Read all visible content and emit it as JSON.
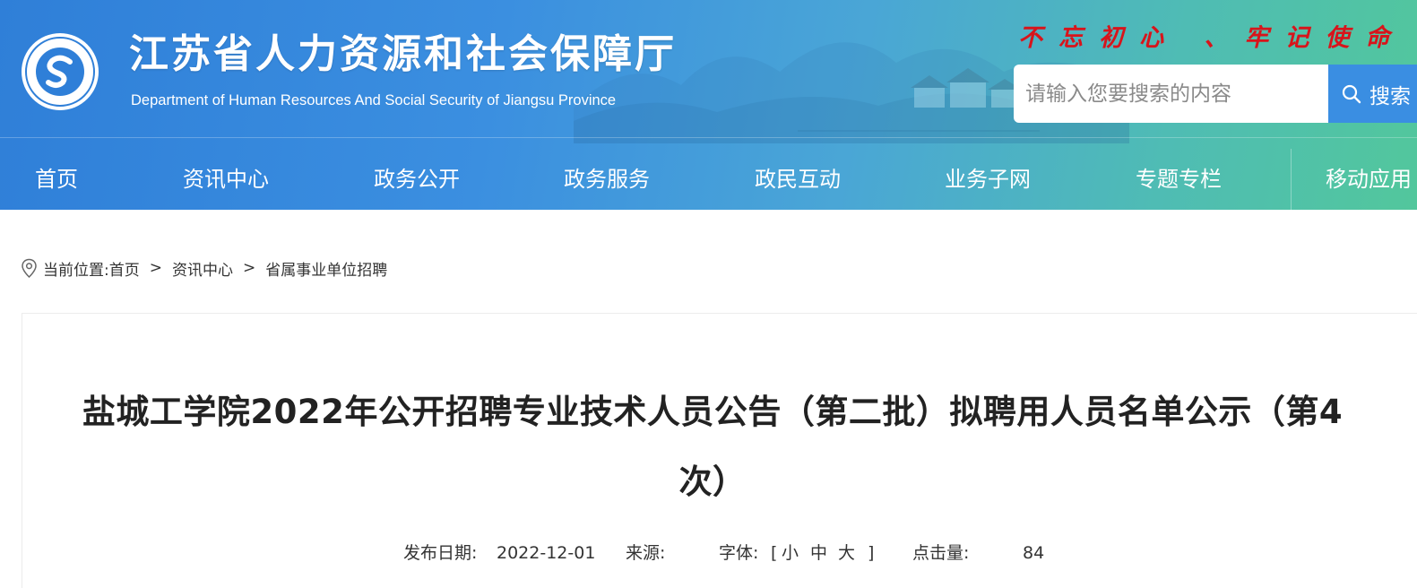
{
  "header": {
    "site_title": "江苏省人力资源和社会保障厅",
    "site_subtitle": "Department of Human Resources And Social Security of Jiangsu Province",
    "slogan": "不忘初心 、牢记使命",
    "emblem_icon": "jiangsu-hrss-emblem-icon"
  },
  "search": {
    "placeholder": "请输入您要搜索的内容",
    "button_label": "搜索"
  },
  "nav": {
    "items": [
      {
        "label": "首页"
      },
      {
        "label": "资讯中心"
      },
      {
        "label": "政务公开"
      },
      {
        "label": "政务服务"
      },
      {
        "label": "政民互动"
      },
      {
        "label": "业务子网"
      },
      {
        "label": "专题专栏"
      },
      {
        "label": "移动应用"
      }
    ]
  },
  "breadcrumb": {
    "prefix": "当前位置:",
    "items": [
      "首页",
      "资讯中心",
      "省属事业单位招聘"
    ],
    "separator": ">"
  },
  "article": {
    "title": "盐城工学院2022年公开招聘专业技术人员公告（第二批）拟聘用人员名单公示（第4次）",
    "date_label": "发布日期:",
    "date": "2022-12-01",
    "source_label": "来源:",
    "source": "",
    "font_label": "字体:",
    "font_open": "[",
    "font_small": "小",
    "font_medium": "中",
    "font_large": "大",
    "font_close": "]",
    "hits_label": "点击量:",
    "hits": "84"
  },
  "colors": {
    "header_start": "#2f7fd8",
    "header_end": "#52c79c",
    "slogan": "#d8141b",
    "search_button": "#3a8ee2"
  }
}
